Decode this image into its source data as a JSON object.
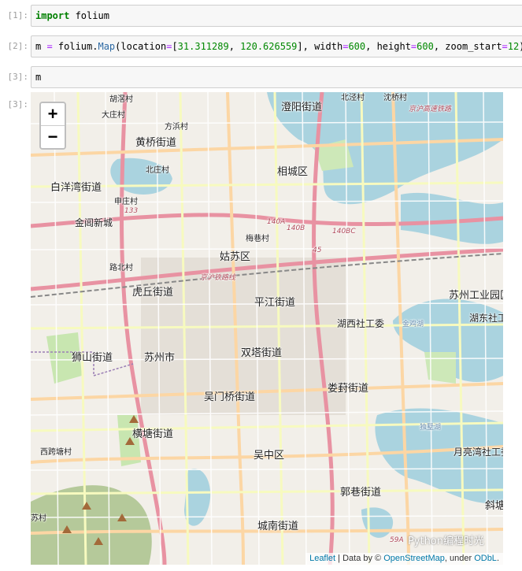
{
  "cells": [
    {
      "prompt": "[1]:",
      "tokens": [
        [
          "kw",
          "import"
        ],
        [
          "plain",
          " folium"
        ]
      ]
    },
    {
      "prompt": "[2]:",
      "tokens": [
        [
          "plain",
          "m "
        ],
        [
          "op",
          "="
        ],
        [
          "plain",
          " folium."
        ],
        [
          "fn",
          "Map"
        ],
        [
          "plain",
          "(location"
        ],
        [
          "op",
          "="
        ],
        [
          "plain",
          "["
        ],
        [
          "num",
          "31.311289"
        ],
        [
          "plain",
          ", "
        ],
        [
          "num",
          "120.626559"
        ],
        [
          "plain",
          "], width"
        ],
        [
          "op",
          "="
        ],
        [
          "num",
          "600"
        ],
        [
          "plain",
          ", height"
        ],
        [
          "op",
          "="
        ],
        [
          "num",
          "600"
        ],
        [
          "plain",
          ", zoom_start"
        ],
        [
          "op",
          "="
        ],
        [
          "num",
          "12"
        ],
        [
          "plain",
          ")"
        ]
      ]
    },
    {
      "prompt": "[3]:",
      "tokens": [
        [
          "plain",
          "m"
        ]
      ]
    }
  ],
  "output_prompt": "[3]:",
  "zoom": {
    "in": "+",
    "out": "−"
  },
  "attribution": {
    "leaflet": "Leaflet",
    "sep": " | Data by © ",
    "osm": "OpenStreetMap",
    "under": ", under ",
    "odbl": "ODbL",
    "end": "."
  },
  "watermark": "Python编程时光",
  "labels": [
    {
      "t": "胡滘村",
      "c": "l-sm"
    },
    {
      "t": "大庄村",
      "c": "l-sm"
    },
    {
      "t": "方浜村",
      "c": "l-sm"
    },
    {
      "t": "黄桥街道",
      "c": "l-big"
    },
    {
      "t": "澄阳街道",
      "c": "l-big"
    },
    {
      "t": "北泾村",
      "c": "l-sm"
    },
    {
      "t": "沈桥村",
      "c": "l-sm"
    },
    {
      "t": "北庄村",
      "c": "l-sm"
    },
    {
      "t": "相城区",
      "c": "l-big"
    },
    {
      "t": "白洋湾街道",
      "c": "l-big"
    },
    {
      "t": "申庄村",
      "c": "l-sm"
    },
    {
      "t": "金阊新城",
      "c": "l-mid"
    },
    {
      "t": "梅巷村",
      "c": "l-sm"
    },
    {
      "t": "姑苏区",
      "c": "l-big"
    },
    {
      "t": "路北村",
      "c": "l-sm"
    },
    {
      "t": "虎丘街道",
      "c": "l-big"
    },
    {
      "t": "平江街道",
      "c": "l-big"
    },
    {
      "t": "苏州工业园区",
      "c": "l-big"
    },
    {
      "t": "湖西社工委",
      "c": "l-mid"
    },
    {
      "t": "湖东社工",
      "c": "l-mid"
    },
    {
      "t": "狮山街道",
      "c": "l-big"
    },
    {
      "t": "苏州市",
      "c": "l-big"
    },
    {
      "t": "双塔街道",
      "c": "l-big"
    },
    {
      "t": "吴门桥街道",
      "c": "l-big"
    },
    {
      "t": "娄葑街道",
      "c": "l-big"
    },
    {
      "t": "横塘街道",
      "c": "l-big"
    },
    {
      "t": "西跨塘村",
      "c": "l-sm"
    },
    {
      "t": "吴中区",
      "c": "l-big"
    },
    {
      "t": "月亮湾社工委",
      "c": "l-mid"
    },
    {
      "t": "郭巷街道",
      "c": "l-big"
    },
    {
      "t": "斜塘",
      "c": "l-big"
    },
    {
      "t": "苏村",
      "c": "l-sm"
    },
    {
      "t": "城南街道",
      "c": "l-big"
    },
    {
      "t": "金鸡湖",
      "c": "l-water"
    },
    {
      "t": "独墅湖",
      "c": "l-water"
    },
    {
      "t": "京沪高速铁路",
      "c": "l-road"
    },
    {
      "t": "140A",
      "c": "l-road"
    },
    {
      "t": "140B",
      "c": "l-road"
    },
    {
      "t": "140BC",
      "c": "l-road"
    },
    {
      "t": "133",
      "c": "l-road"
    },
    {
      "t": "45",
      "c": "l-road"
    },
    {
      "t": "59A",
      "c": "l-road"
    },
    {
      "t": "京沪铁路线",
      "c": "l-road"
    }
  ]
}
